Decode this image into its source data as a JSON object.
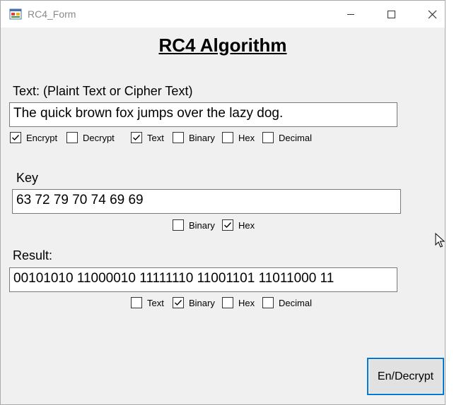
{
  "window": {
    "title": "RC4_Form"
  },
  "heading": "RC4 Algorithm",
  "text_section": {
    "label": "Text: (Plaint Text or Cipher Text)",
    "value": "The quick brown fox jumps over the lazy dog.",
    "options": [
      {
        "label": "Encrypt",
        "checked": true
      },
      {
        "label": "Decrypt",
        "checked": false
      },
      {
        "label": "Text",
        "checked": true
      },
      {
        "label": "Binary",
        "checked": false
      },
      {
        "label": "Hex",
        "checked": false
      },
      {
        "label": "Decimal",
        "checked": false
      }
    ]
  },
  "key_section": {
    "label": "Key",
    "value": "63 72 79 70 74 69 69",
    "options": [
      {
        "label": "Binary",
        "checked": false
      },
      {
        "label": "Hex",
        "checked": true
      }
    ]
  },
  "result_section": {
    "label": "Result:",
    "value": "00101010 11000010 11111110 11001101 11011000 11",
    "options": [
      {
        "label": "Text",
        "checked": false
      },
      {
        "label": "Binary",
        "checked": true
      },
      {
        "label": "Hex",
        "checked": false
      },
      {
        "label": "Decimal",
        "checked": false
      }
    ]
  },
  "action_button": {
    "label": "En/Decrypt"
  },
  "colors": {
    "focus_border": "#0078d7",
    "form_bg": "#f0f0f0",
    "title_text": "#8a8a8a"
  },
  "icons": [
    "app-form-icon",
    "minimize-icon",
    "maximize-icon",
    "close-icon",
    "mouse-cursor-icon"
  ]
}
